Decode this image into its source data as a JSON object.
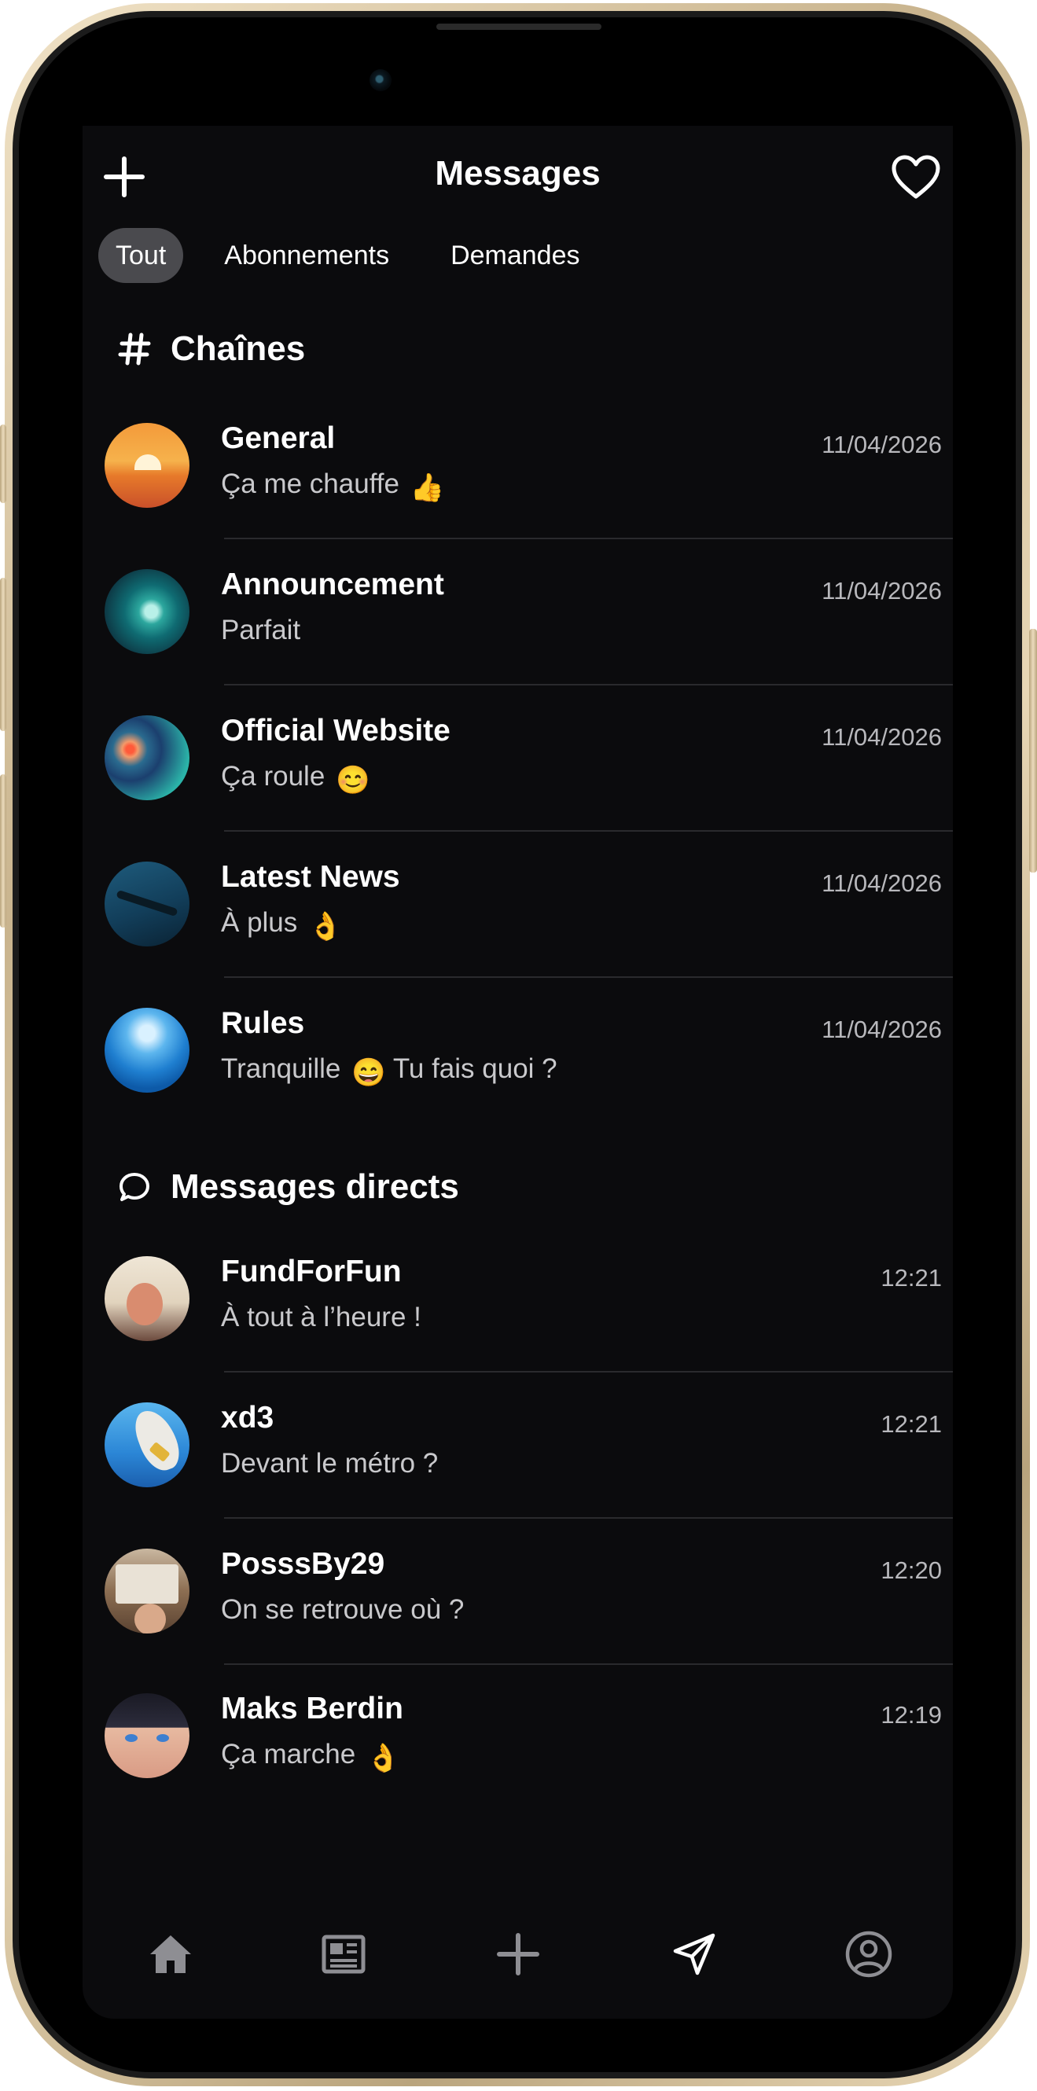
{
  "header": {
    "title": "Messages",
    "add_icon": "plus-icon",
    "heart_icon": "heart-icon"
  },
  "tabs": [
    {
      "label": "Tout",
      "active": true
    },
    {
      "label": "Abonnements",
      "active": false
    },
    {
      "label": "Demandes",
      "active": false
    }
  ],
  "channels": {
    "title": "Chaînes",
    "icon": "hashtag-icon",
    "items": [
      {
        "name": "General",
        "preview": "Ça me chauffe",
        "emoji": "👍",
        "time": "11/04/2026"
      },
      {
        "name": "Announcement",
        "preview": "Parfait",
        "emoji": "",
        "time": "11/04/2026"
      },
      {
        "name": "Official Website",
        "preview": "Ça roule",
        "emoji": "😊",
        "time": "11/04/2026"
      },
      {
        "name": "Latest News",
        "preview": "À plus",
        "emoji": "👌",
        "time": "11/04/2026"
      },
      {
        "name": "Rules",
        "preview": "Tranquille",
        "emoji": "😄",
        "preview_after": "Tu fais quoi ?",
        "time": "11/04/2026"
      }
    ]
  },
  "direct": {
    "title": "Messages directs",
    "icon": "chat-bubble-icon",
    "items": [
      {
        "name": "FundForFun",
        "preview": "À tout à l’heure !",
        "time": "12:21"
      },
      {
        "name": "xd3",
        "preview": "Devant le métro ?",
        "time": "12:21"
      },
      {
        "name": "PosssBy29",
        "preview": "On se retrouve où ?",
        "time": "12:20"
      },
      {
        "name": "Maks Berdin",
        "preview": "Ça marche",
        "emoji": "👌",
        "time": "12:19"
      }
    ]
  },
  "tabbar": [
    "home-icon",
    "news-icon",
    "create-plus-icon",
    "send-icon",
    "profile-icon"
  ],
  "colors": {
    "background": "#0b0b0d",
    "active_tab": "#4a4a4e",
    "divider": "#2a2a2d",
    "muted_text": "#c9c9cc"
  }
}
